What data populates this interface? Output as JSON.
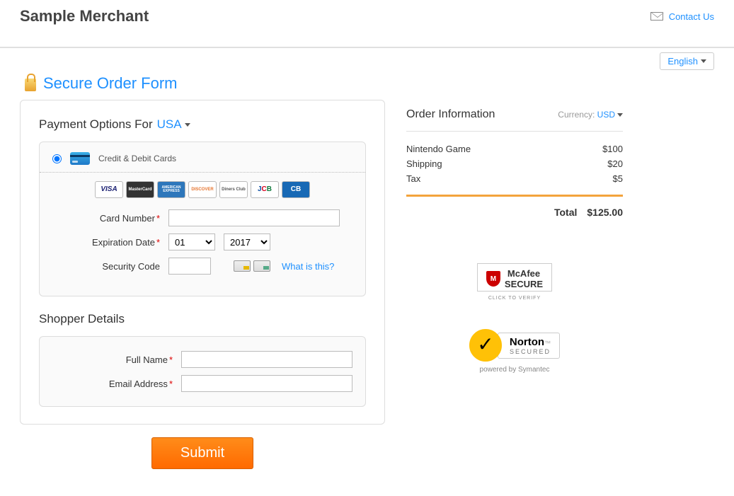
{
  "header": {
    "merchant": "Sample Merchant",
    "contact_link": "Contact Us"
  },
  "lang": {
    "current": "English"
  },
  "secure_title": "Secure Order Form",
  "payment": {
    "title_prefix": "Payment Options For",
    "country": "USA",
    "method_label": "Credit & Debit Cards",
    "cards": {
      "visa": "VISA",
      "mc": "MasterCard",
      "amex": "AMERICAN EXPRESS",
      "discover": "DISCOVER",
      "diners": "Diners Club",
      "jcb": "JCB",
      "cb": "CB"
    },
    "labels": {
      "card_number": "Card Number",
      "exp_date": "Expiration Date",
      "security_code": "Security Code",
      "what_is_this": "What is this?"
    },
    "values": {
      "exp_month": "01",
      "exp_year": "2017"
    }
  },
  "shopper": {
    "title": "Shopper Details",
    "labels": {
      "full_name": "Full Name",
      "email": "Email Address"
    }
  },
  "submit_label": "Submit",
  "order": {
    "title": "Order Information",
    "currency_label": "Currency:",
    "currency": "USD",
    "items": [
      {
        "name": "Nintendo Game",
        "price": "$100"
      },
      {
        "name": "Shipping",
        "price": "$20"
      },
      {
        "name": "Tax",
        "price": "$5"
      }
    ],
    "total_label": "Total",
    "total": "$125.00"
  },
  "trust": {
    "mcafee_line1": "McAfee",
    "mcafee_line2": "SECURE",
    "mcafee_verify": "CLICK TO VERIFY",
    "norton_name": "Norton",
    "norton_secured": "SECURED",
    "norton_powered": "powered by Symantec"
  }
}
